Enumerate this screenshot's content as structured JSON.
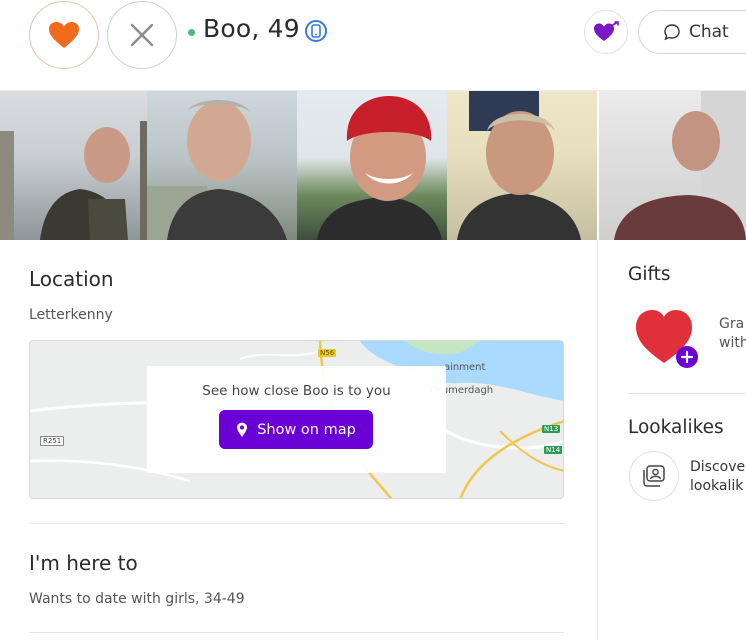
{
  "header": {
    "name": "Boo, 49",
    "chat_label": "Chat",
    "like_icon": "heart-icon",
    "pass_icon": "close-icon",
    "device_icon": "phone-icon",
    "online_color": "#4dbb77",
    "like_color": "#f26a1b"
  },
  "photos": [
    {
      "alt": "profile-photo-1"
    },
    {
      "alt": "profile-photo-2"
    },
    {
      "alt": "profile-photo-3"
    },
    {
      "alt": "profile-photo-4"
    },
    {
      "alt": "profile-photo-5"
    }
  ],
  "location": {
    "heading": "Location",
    "value": "Letterkenny",
    "map_prompt": "See how close Boo is to you",
    "map_button": "Show on map",
    "map_labels": {
      "place": "Drumerdagh",
      "partial": "ainment",
      "road_n56": "N56",
      "road_n13": "N13",
      "road_n14": "N14",
      "road_r251": "R251"
    }
  },
  "here_to": {
    "heading": "I'm here to",
    "value": "Wants to date with girls, 34-49"
  },
  "sidebar": {
    "gifts_heading": "Gifts",
    "gift_text_line1": "Gra",
    "gift_text_line2": "with",
    "lookalikes_heading": "Lookalikes",
    "lookalikes_text_line1": "Discove",
    "lookalikes_text_line2": "lookalik"
  },
  "colors": {
    "accent": "#6a00d6",
    "gift_heart": "#e0303a"
  }
}
